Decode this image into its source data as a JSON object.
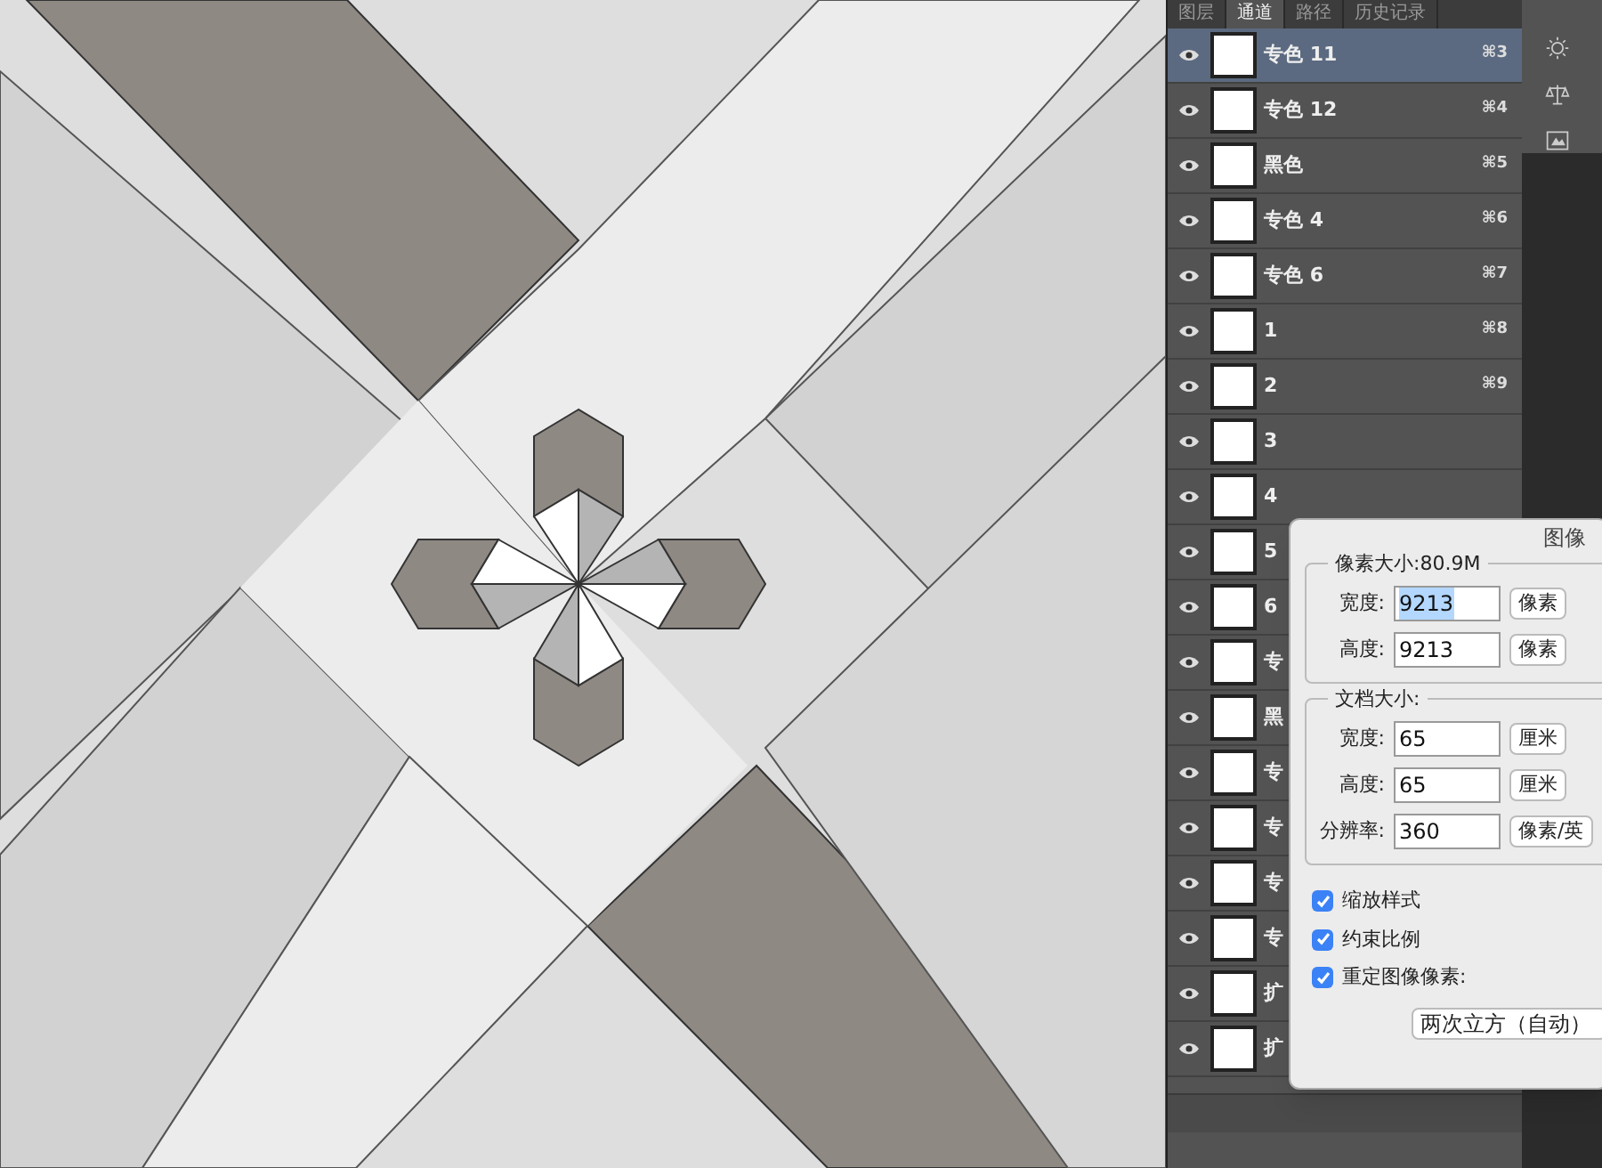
{
  "panel": {
    "tabs": [
      {
        "label": "图层",
        "selected": false
      },
      {
        "label": "通道",
        "selected": true
      },
      {
        "label": "路径",
        "selected": false
      },
      {
        "label": "历史记录",
        "selected": false
      }
    ],
    "channels": [
      {
        "name": "专色 11",
        "shortcut": "⌘3",
        "selected": true
      },
      {
        "name": "专色 12",
        "shortcut": "⌘4",
        "selected": false
      },
      {
        "name": "黑色",
        "shortcut": "⌘5",
        "selected": false
      },
      {
        "name": "专色 4",
        "shortcut": "⌘6",
        "selected": false
      },
      {
        "name": "专色 6",
        "shortcut": "⌘7",
        "selected": false
      },
      {
        "name": "1",
        "shortcut": "⌘8",
        "selected": false
      },
      {
        "name": "2",
        "shortcut": "⌘9",
        "selected": false
      },
      {
        "name": "3",
        "selected": false
      },
      {
        "name": "4",
        "selected": false
      },
      {
        "name": "5",
        "selected": false
      },
      {
        "name": "6",
        "selected": false
      },
      {
        "name": "专",
        "selected": false
      },
      {
        "name": "黑",
        "selected": false
      },
      {
        "name": "专",
        "selected": false
      },
      {
        "name": "专",
        "selected": false
      },
      {
        "name": "专",
        "selected": false
      },
      {
        "name": "专",
        "selected": false
      },
      {
        "name": "扩",
        "selected": false
      },
      {
        "name": "扩",
        "selected": false
      }
    ]
  },
  "dialog": {
    "title": "图像",
    "sections": [
      {
        "legend": "像素大小:80.9M",
        "fields": [
          {
            "label": "宽度:",
            "value": "9213",
            "unit": "像素",
            "highlighted": true
          },
          {
            "label": "高度:",
            "value": "9213",
            "unit": "像素",
            "highlighted": false
          }
        ]
      },
      {
        "legend": "文档大小:",
        "fields": [
          {
            "label": "宽度:",
            "value": "65",
            "unit": "厘米",
            "highlighted": false
          },
          {
            "label": "高度:",
            "value": "65",
            "unit": "厘米",
            "highlighted": false
          },
          {
            "label": "分辨率:",
            "value": "360",
            "unit": "像素/英",
            "highlighted": false
          }
        ]
      }
    ],
    "options": [
      {
        "label": "缩放样式",
        "checked": true
      },
      {
        "label": "约束比例",
        "checked": true
      },
      {
        "label": "重定图像像素:",
        "checked": true
      }
    ],
    "resample_method": "两次立方（自动）"
  }
}
